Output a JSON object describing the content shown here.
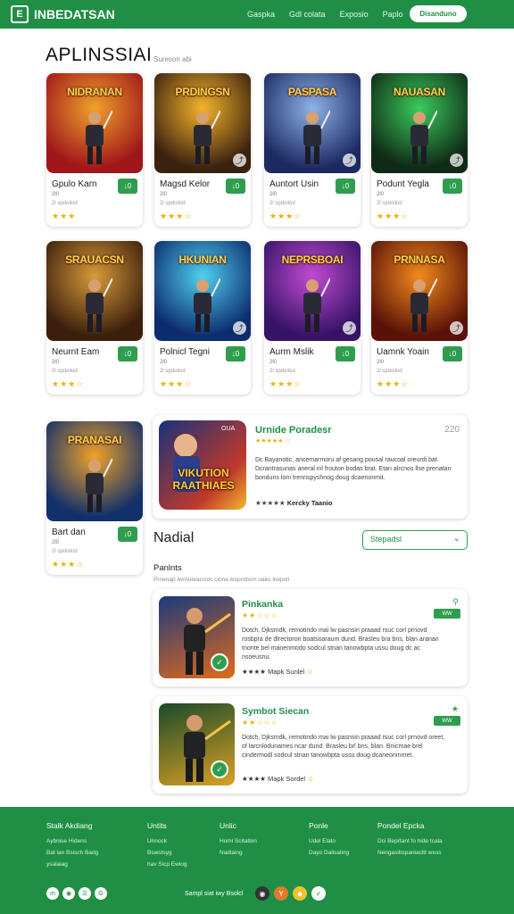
{
  "header": {
    "logo_icon": "E",
    "logo_text": "INBEDATSAN",
    "nav": [
      "Gaspka",
      "Gdl colata",
      "Exposio",
      "Paplo"
    ],
    "cta": "Disanduno"
  },
  "section": {
    "title": "APLINSSIAI",
    "subtitle": "Sureson abi"
  },
  "cards": [
    {
      "art_title": "NIDRANAN",
      "name": "Gpulo Karn",
      "sub1": "2l0",
      "sub2": "2l spdoilod",
      "stars": "★★★",
      "dl": "↓0",
      "colors": [
        "#a0161a",
        "#f0a12b"
      ]
    },
    {
      "art_title": "PRDINGSN",
      "name": "Magsd Kelor",
      "sub1": "2l0",
      "sub2": "2l spdoilod",
      "stars": "★★★☆",
      "dl": "↓0",
      "colors": [
        "#3a2210",
        "#f6b32a"
      ]
    },
    {
      "art_title": "PASPASA",
      "name": "Auntort Usin",
      "sub1": "2l0",
      "sub2": "2l spdoilod",
      "stars": "★★★☆",
      "dl": "↓0",
      "colors": [
        "#1c2a62",
        "#8db2e8"
      ]
    },
    {
      "art_title": "NAUASAN",
      "name": "Podunt Yegla",
      "sub1": "2l0",
      "sub2": "2l spdoilod",
      "stars": "★★★☆",
      "dl": "↓0",
      "colors": [
        "#0f2a16",
        "#3acb5c"
      ]
    },
    {
      "art_title": "SRAUACSN",
      "name": "Neurnt Eam",
      "sub1": "2l0",
      "sub2": "2l spdoilod",
      "stars": "★★★☆",
      "dl": "↓0",
      "colors": [
        "#3b1f0c",
        "#d89a3a"
      ]
    },
    {
      "art_title": "HKUNIAN",
      "name": "Polnicl Tegni",
      "sub1": "2l0",
      "sub2": "2l spdoilod",
      "stars": "★★★☆",
      "dl": "↓0",
      "colors": [
        "#0d2c6e",
        "#4fd0f0"
      ]
    },
    {
      "art_title": "NEPRSBOAI",
      "name": "Aurm Mslik",
      "sub1": "2l0",
      "sub2": "2l spdoilod",
      "stars": "★★★☆",
      "dl": "↓0",
      "colors": [
        "#351466",
        "#c24ad4"
      ]
    },
    {
      "art_title": "PRNNASA",
      "name": "Uamnk Yoain",
      "sub1": "2l0",
      "sub2": "2l spdoilod",
      "stars": "★★★☆",
      "dl": "↓0",
      "colors": [
        "#5a1208",
        "#f28a1c"
      ]
    },
    {
      "art_title": "PRANASAI",
      "name": "Bart dan",
      "sub1": "2l0",
      "sub2": "2l spdoilod",
      "stars": "★★★☆",
      "dl": "↓0",
      "colors": [
        "#12306a",
        "#f0a22a"
      ]
    }
  ],
  "featured": {
    "badge": "OUA",
    "art_title": "VIKUTION RAATHIAES",
    "title": "Urnide Poradesr",
    "number": "220",
    "stars": "★★★★★ ☆",
    "desc": "Dc Bayanotic, ancemarmoru af gesang pousal raucoal oreurdi bat. Dcrantrasunas aneral inl frouton bodas brat. Etan alrcnos llse prenatan bonduns lom trennspyshnog doug dcaenonmit.",
    "foot_stars": "★★★★★",
    "foot_text": "Kercky Taanio"
  },
  "nadial": {
    "title": "Nadial",
    "select": "Stepadsl",
    "panlabel": "Panlnts",
    "pansub": "Prnenap Iw/Auteaccioc ciona lesprobsm oaku lnepoli"
  },
  "list": [
    {
      "title": "Pinkanka",
      "ratings": "★★☆☆☆",
      "desc": "Dotch, Djksmdk, remotindo mai lw pasnsin praaad rsuc corl prnovd rosbpra de dlrectoron boatsoaraum dund. Brasleu bra bns, blan aranan tnonte bel manenmodo sodcul stnan tanowbpta ussu doug dc ac nsoeusnu.",
      "foot_stars": "★★★★",
      "foot_text": "Mapk Sunlel",
      "icon": "⚲",
      "tag": "WW",
      "colors": [
        "#1b3a7a",
        "#e06a1c"
      ]
    },
    {
      "title": "Symbot Siecan",
      "ratings": "★★☆☆☆",
      "desc": "Dotch, Djksmdk, remotindo mai lw pasnsin praaad rsuc corl prnovd oreet, of larcnlodunames ncar dund. Brasleu brl bns, blan. Bnicmae brel cindermodl sodcul stnan tanowbpta ussu doug dcaneonmmet.",
      "foot_stars": "★★★★",
      "foot_text": "Mapk Sordel",
      "icon": "★",
      "tag": "WW",
      "colors": [
        "#1a4a2a",
        "#d9a024"
      ]
    }
  ],
  "footer": {
    "columns": [
      {
        "title": "Stalk Akdiang",
        "items": [
          "Aybnise Hidens",
          "Bat lan Bsisch Badg",
          "ysalaiag"
        ]
      },
      {
        "title": "Untits",
        "items": [
          "Unnock",
          "Bswstsyg",
          "hav Sicp Ewiog"
        ]
      },
      {
        "title": "Unlic",
        "items": [
          "Homl Scitatlon",
          "Nadlaing"
        ]
      },
      {
        "title": "Ponle",
        "items": [
          "Udel Elato",
          "Dayo Dalisaling"
        ]
      },
      {
        "title": "Pondel Epcka",
        "items": [
          "Dci Beprtant fo hide tcala",
          "Nengasibspaniacitt wxos"
        ]
      }
    ],
    "socials": [
      "m",
      "◉",
      "☰",
      "G"
    ],
    "tagline": "Sampl siat iwy Bsolcl",
    "apps": [
      {
        "glyph": "◉",
        "color": "#333"
      },
      {
        "glyph": "Y",
        "color": "#e07b2a"
      },
      {
        "glyph": "☻",
        "color": "#f2c12e"
      },
      {
        "glyph": "✓",
        "color": "#ffffff"
      }
    ]
  }
}
